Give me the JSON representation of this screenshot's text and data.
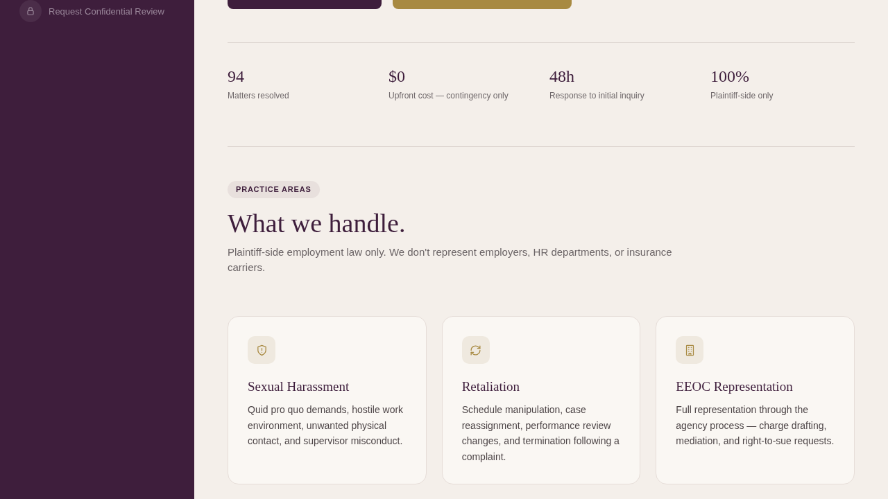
{
  "sidebar": {
    "items": [
      {
        "label": "Request Confidential Review"
      }
    ]
  },
  "hero_buttons": [
    {
      "kind": "primary"
    },
    {
      "kind": "secondary"
    }
  ],
  "stats": [
    {
      "value": "94",
      "label": "Matters resolved"
    },
    {
      "value": "$0",
      "label": "Upfront cost — contingency only"
    },
    {
      "value": "48h",
      "label": "Response to initial inquiry"
    },
    {
      "value": "100%",
      "label": "Plaintiff-side only"
    }
  ],
  "practice_areas": {
    "badge": "PRACTICE AREAS",
    "heading": "What we handle.",
    "intro": "Plaintiff-side employment law only. We don't represent employers, HR departments, or insurance carriers.",
    "cards": [
      {
        "title": "Sexual Harassment",
        "description": "Quid pro quo demands, hostile work environment, unwanted physical contact, and supervisor misconduct."
      },
      {
        "title": "Retaliation",
        "description": "Schedule manipulation, case reassignment, performance review changes, and termination following a complaint."
      },
      {
        "title": "EEOC Representation",
        "description": "Full representation through the agency process — charge drafting, mediation, and right-to-sue requests."
      }
    ]
  }
}
